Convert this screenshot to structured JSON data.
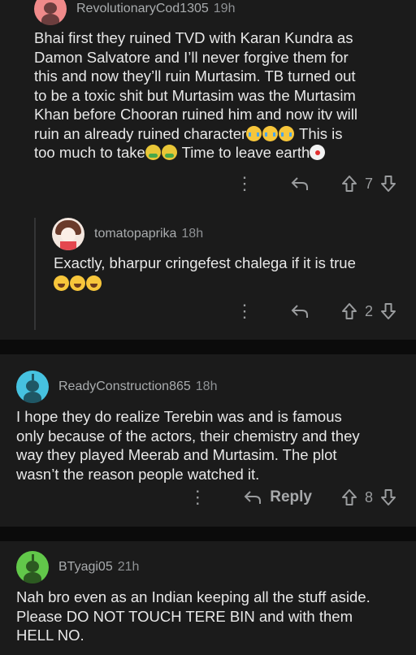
{
  "comments": [
    {
      "username": "RevolutionaryCod1305",
      "time": "19h",
      "lines": [
        "Bhai first they ruined TVD with Karan Kundra as",
        "Damon Salvatore and I’ll never forgive them for",
        "this and now they’ll ruin Murtasim. TB turned out",
        "to be a toxic shit but Murtasim was the Murtasim",
        "Khan before Chooran ruined him and now itv will",
        "ruin an already ruined character"
      ],
      "line6_after": " This is",
      "line7_start": "too much to take",
      "line7_after": " Time to leave earth",
      "votes": "7",
      "avatar_color": "#f08a8a"
    },
    {
      "username": "tomatopaprika",
      "time": "18h",
      "text": "Exactly, bharpur cringefest chalega if it is true",
      "votes": "2"
    },
    {
      "username": "ReadyConstruction865",
      "time": "18h",
      "lines": [
        "I hope they do realize Terebin was and is famous",
        "only because of the actors, their chemistry and they",
        "way they played Meerab and Murtasim. The plot",
        "wasn’t the reason people watched it."
      ],
      "reply_label": "Reply",
      "votes": "8",
      "avatar_color": "#46c2e0"
    },
    {
      "username": "BTyagi05",
      "time": "21h",
      "lines": [
        "Nah bro even as an Indian keeping all the stuff aside.",
        "Please DO NOT TOUCH TERE BIN and with them",
        "HELL NO."
      ],
      "avatar_color": "#62c84a"
    }
  ],
  "icons": {
    "more": "vertical-dots-icon",
    "reply": "reply-arrow-icon",
    "upvote": "upvote-arrow-icon",
    "downvote": "downvote-arrow-icon"
  }
}
